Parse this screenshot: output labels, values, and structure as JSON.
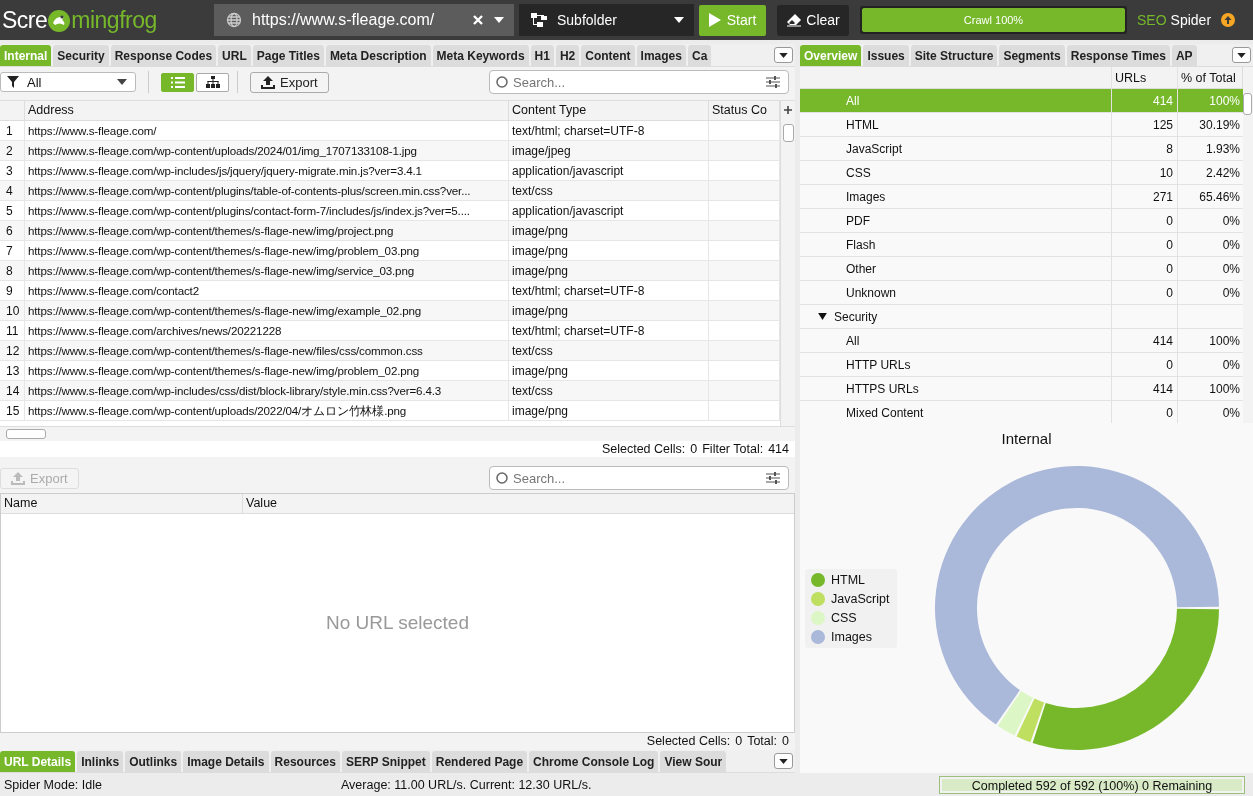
{
  "topbar": {
    "logo": {
      "before": "Scre",
      "after": "mingfrog"
    },
    "url_field": {
      "value": "https://www.s-fleage.com/"
    },
    "mode_dropdown": {
      "value": "Subfolder"
    },
    "start_button": "Start",
    "clear_button": "Clear",
    "crawl_progress": {
      "label": "Crawl 100%",
      "level": 1
    },
    "brand": {
      "prefix": "SEO",
      "name": "Spider"
    }
  },
  "left_tabs": [
    {
      "label": "Internal",
      "selected": true
    },
    {
      "label": "Security",
      "selected": false
    },
    {
      "label": "Response Codes",
      "selected": false
    },
    {
      "label": "URL",
      "selected": false
    },
    {
      "label": "Page Titles",
      "selected": false
    },
    {
      "label": "Meta Description",
      "selected": false
    },
    {
      "label": "Meta Keywords",
      "selected": false
    },
    {
      "label": "H1",
      "selected": false
    },
    {
      "label": "H2",
      "selected": false
    },
    {
      "label": "Content",
      "selected": false
    },
    {
      "label": "Images",
      "selected": false
    },
    {
      "label": "Ca",
      "selected": false
    }
  ],
  "toolbar": {
    "filter": "All",
    "views": [
      {
        "kind": "list",
        "selected": true
      },
      {
        "kind": "tree",
        "selected": false
      }
    ],
    "export_button": "Export",
    "search": {
      "placeholder": "Search..."
    }
  },
  "table": {
    "columns": [
      "Address",
      "Content Type",
      "Status Co"
    ],
    "rows": [
      {
        "number": "1",
        "address": "https://www.s-fleage.com/",
        "content_type": "text/html; charset=UTF-8"
      },
      {
        "number": "2",
        "address": "https://www.s-fleage.com/wp-content/uploads/2024/01/img_1707133108-1.jpg",
        "content_type": "image/jpeg"
      },
      {
        "number": "3",
        "address": "https://www.s-fleage.com/wp-includes/js/jquery/jquery-migrate.min.js?ver=3.4.1",
        "content_type": "application/javascript"
      },
      {
        "number": "4",
        "address": "https://www.s-fleage.com/wp-content/plugins/table-of-contents-plus/screen.min.css?ver...",
        "content_type": "text/css"
      },
      {
        "number": "5",
        "address": "https://www.s-fleage.com/wp-content/plugins/contact-form-7/includes/js/index.js?ver=5....",
        "content_type": "application/javascript"
      },
      {
        "number": "6",
        "address": "https://www.s-fleage.com/wp-content/themes/s-flage-new/img/project.png",
        "content_type": "image/png"
      },
      {
        "number": "7",
        "address": "https://www.s-fleage.com/wp-content/themes/s-flage-new/img/problem_03.png",
        "content_type": "image/png"
      },
      {
        "number": "8",
        "address": "https://www.s-fleage.com/wp-content/themes/s-flage-new/img/service_03.png",
        "content_type": "image/png"
      },
      {
        "number": "9",
        "address": "https://www.s-fleage.com/contact2",
        "content_type": "text/html; charset=UTF-8"
      },
      {
        "number": "10",
        "address": "https://www.s-fleage.com/wp-content/themes/s-flage-new/img/example_02.png",
        "content_type": "image/png"
      },
      {
        "number": "11",
        "address": "https://www.s-fleage.com/archives/news/20221228",
        "content_type": "text/html; charset=UTF-8"
      },
      {
        "number": "12",
        "address": "https://www.s-fleage.com/wp-content/themes/s-flage-new/files/css/common.css",
        "content_type": "text/css"
      },
      {
        "number": "13",
        "address": "https://www.s-fleage.com/wp-content/themes/s-flage-new/img/problem_02.png",
        "content_type": "image/png"
      },
      {
        "number": "14",
        "address": "https://www.s-fleage.com/wp-includes/css/dist/block-library/style.min.css?ver=6.4.3",
        "content_type": "text/css"
      },
      {
        "number": "15",
        "address": "https://www.s-fleage.com/wp-content/uploads/2022/04/オムロン竹林様.png",
        "content_type": "image/png"
      }
    ]
  },
  "table_footer": {
    "selected_label": "Selected Cells:",
    "selected": "0",
    "total_label": "Filter Total:",
    "total": "414"
  },
  "details": {
    "export_button": {
      "label": "Export",
      "disabled": true
    },
    "search": {
      "placeholder": "Search..."
    },
    "columns": [
      "Name",
      "Value"
    ],
    "empty_message": "No URL selected",
    "footer": {
      "selected_label": "Selected Cells:",
      "selected": "0",
      "total_label": "Total:",
      "total": "0"
    }
  },
  "bottom_tabs": [
    {
      "label": "URL Details",
      "selected": true
    },
    {
      "label": "Inlinks",
      "selected": false
    },
    {
      "label": "Outlinks",
      "selected": false
    },
    {
      "label": "Image Details",
      "selected": false
    },
    {
      "label": "Resources",
      "selected": false
    },
    {
      "label": "SERP Snippet",
      "selected": false
    },
    {
      "label": "Rendered Page",
      "selected": false
    },
    {
      "label": "Chrome Console Log",
      "selected": false
    },
    {
      "label": "View Sour",
      "selected": false
    }
  ],
  "right_tabs": [
    {
      "label": "Overview",
      "selected": true
    },
    {
      "label": "Issues",
      "selected": false
    },
    {
      "label": "Site Structure",
      "selected": false
    },
    {
      "label": "Segments",
      "selected": false
    },
    {
      "label": "Response Times",
      "selected": false
    },
    {
      "label": "AP",
      "selected": false
    }
  ],
  "overview": {
    "columns": [
      "URLs",
      "% of Total"
    ],
    "rows": [
      {
        "kind": "item",
        "label": "All",
        "urls": "414",
        "percent": "100%",
        "selected": true
      },
      {
        "kind": "item",
        "label": "HTML",
        "urls": "125",
        "percent": "30.19%",
        "selected": false
      },
      {
        "kind": "item",
        "label": "JavaScript",
        "urls": "8",
        "percent": "1.93%",
        "selected": false
      },
      {
        "kind": "item",
        "label": "CSS",
        "urls": "10",
        "percent": "2.42%",
        "selected": false
      },
      {
        "kind": "item",
        "label": "Images",
        "urls": "271",
        "percent": "65.46%",
        "selected": false
      },
      {
        "kind": "item",
        "label": "PDF",
        "urls": "0",
        "percent": "0%",
        "selected": false
      },
      {
        "kind": "item",
        "label": "Flash",
        "urls": "0",
        "percent": "0%",
        "selected": false
      },
      {
        "kind": "item",
        "label": "Other",
        "urls": "0",
        "percent": "0%",
        "selected": false
      },
      {
        "kind": "item",
        "label": "Unknown",
        "urls": "0",
        "percent": "0%",
        "selected": false
      },
      {
        "kind": "group",
        "label": "Security",
        "expanded": true,
        "selected": false,
        "children": [
          {
            "kind": "item",
            "label": "All",
            "urls": "414",
            "percent": "100%",
            "selected": false
          },
          {
            "kind": "item",
            "label": "HTTP URLs",
            "urls": "0",
            "percent": "0%",
            "selected": false
          },
          {
            "kind": "item",
            "label": "HTTPS URLs",
            "urls": "414",
            "percent": "100%",
            "selected": false
          },
          {
            "kind": "item",
            "label": "Mixed Content",
            "urls": "0",
            "percent": "0%",
            "selected": false
          }
        ]
      }
    ]
  },
  "chart_panel": {
    "legend": [
      {
        "color": "#76b82a"
      },
      {
        "color": "#bedf5f"
      },
      {
        "color": "#dcf7c5"
      },
      {
        "color": "#aab8da"
      }
    ],
    "chart_data": {
      "type": "donut",
      "title": "Internal",
      "categories": [
        "HTML",
        "JavaScript",
        "CSS",
        "Images"
      ],
      "series": [
        {
          "values": [
            30.19,
            1.93,
            2.42,
            65.46
          ]
        }
      ]
    }
  },
  "status_bar": {
    "mode": "Spider Mode: Idle",
    "rate": "Average: 11.00 URL/s. Current: 12.30 URL/s.",
    "progress": {
      "label": "Completed 592 of 592 (100%) 0 Remaining",
      "level": 1
    }
  }
}
